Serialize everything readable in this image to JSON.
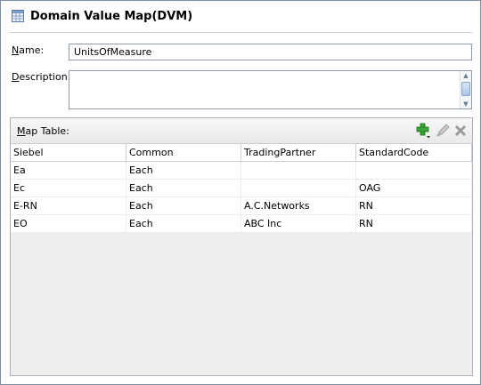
{
  "window": {
    "title": "Domain Value Map(DVM)",
    "icon": "table-grid-icon"
  },
  "form": {
    "name_label_mnemonic": "N",
    "name_label_rest": "ame:",
    "name_value": "UnitsOfMeasure",
    "description_label_mnemonic": "D",
    "description_label_rest": "escription:",
    "description_value": ""
  },
  "map_table": {
    "title_mnemonic": "M",
    "title_rest": "ap Table:",
    "toolbar": {
      "add_icon": "add-plus-icon",
      "edit_icon": "pencil-edit-icon",
      "delete_icon": "delete-x-icon"
    },
    "columns": [
      "Siebel",
      "Common",
      "TradingPartner",
      "StandardCode"
    ],
    "rows": [
      [
        "Ea",
        "Each",
        "",
        ""
      ],
      [
        "Ec",
        "Each",
        "",
        "OAG"
      ],
      [
        "E-RN",
        "Each",
        "A.C.Networks",
        "RN"
      ],
      [
        "EO",
        "Each",
        "ABC Inc",
        "RN"
      ]
    ]
  }
}
